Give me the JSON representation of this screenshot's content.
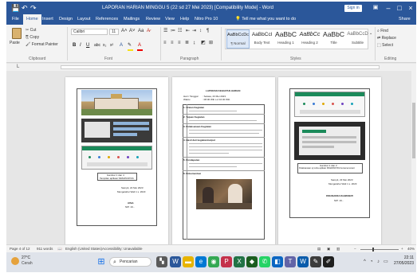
{
  "window": {
    "title": "LAPORAN HARIAN MINGGU 5 (22 sd 27 Mei 2023) [Compatibility Mode] - Word",
    "signin_label": "Sign in",
    "minimize": "–",
    "maximize": "□",
    "close": "×",
    "quick_access": {
      "save": "💾",
      "undo": "↶",
      "redo": "↷"
    }
  },
  "ribbon_tabs": [
    "File",
    "Home",
    "Insert",
    "Design",
    "Layout",
    "References",
    "Mailings",
    "Review",
    "View",
    "Help",
    "Nitro Pro 10"
  ],
  "active_tab": "Home",
  "tell_me": "Tell me what you want to do",
  "share_label": "Share",
  "clipboard": {
    "paste": "Paste",
    "cut": "Cut",
    "copy": "Copy",
    "format_painter": "Format Painter",
    "group": "Clipboard"
  },
  "font": {
    "name": "Calibri",
    "size": "11",
    "group": "Font",
    "bold": "B",
    "italic": "I",
    "underline": "U"
  },
  "paragraph": {
    "group": "Paragraph"
  },
  "styles": {
    "group": "Styles",
    "items": [
      {
        "preview": "AaBbCcDc",
        "name": "¶ Normal"
      },
      {
        "preview": "AaBbCcl",
        "name": "Body Text"
      },
      {
        "preview": "AaBbC",
        "name": "Heading 1"
      },
      {
        "preview": "AaBbCc",
        "name": "Heading 2"
      },
      {
        "preview": "AaBbC",
        "name": "Title"
      },
      {
        "preview": "AaBbCcD",
        "name": "Subtitle"
      }
    ]
  },
  "editing": {
    "find": "Find",
    "replace": "Replace",
    "select": "Select",
    "group": "Editing"
  },
  "ruler": {
    "marker": "L"
  },
  "pages": {
    "p1": {
      "caption_line1": "Gambar 1 dan 4",
      "caption_line2": "Tampilan aplikasi SIMAPANTAS",
      "date": "Sampit, 22 Mei 2023",
      "approval": "Mengetahui Wali 1 s. 2023",
      "name": "Alfah",
      "nip": "NIP. 19..."
    },
    "p2": {
      "title": "LAPORAN KEGIATAN HARIAN",
      "row1_label": "Hari / Tanggal",
      "row1_value": ": Selasa, 23 Mei 2023",
      "row2_label": "Waktu",
      "row2_value": ": 08.00 Wib s.d 16.00 Wib",
      "sec1": "1. Uraian Kegiatan",
      "sec2": "2. Tujuan Kegiatan",
      "sec3": "3. Pelaksanaan Kegiatan",
      "sec4": "4. Hasil dari kegiatan/output",
      "sec5": "5. Pendapatan",
      "sec6": "6. Dokumentasi"
    },
    "p3": {
      "caption_line1": "Gambar 1 dan 2",
      "caption_line2": "Pelaksanaan uji coba aplikasi SIMAPANTAS bersama tenant",
      "date": "Sampit, 23 Mei 2023",
      "approval": "Mengetahui Wali 1 s. 2023",
      "name": "PARAMADIKA RAHMAWATI",
      "nip": "NIP. 19..."
    }
  },
  "status_bar": {
    "page": "Page 4 of 12",
    "words": "911 words",
    "language": "English (United States)",
    "accessibility": "Accessibility: Unavailable",
    "zoom": "40%"
  },
  "taskbar": {
    "temperature": "27°C",
    "weather": "Cerah",
    "search_placeholder": "Pencarian",
    "time": "22:11",
    "date": "27/05/2023"
  },
  "colors": {
    "word_blue": "#2b579a",
    "ribbon_bg": "#f3f3f3",
    "canvas_bg": "#e6e6e6",
    "taskbar_bg": "#dfe3ea"
  }
}
